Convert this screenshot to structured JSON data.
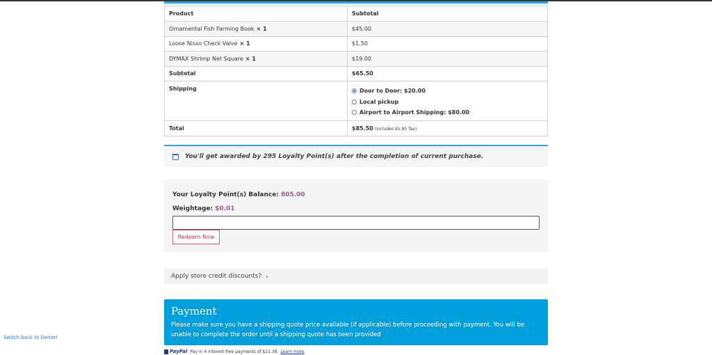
{
  "order_table": {
    "header_product": "Product",
    "header_subtotal": "Subtotal",
    "items": [
      {
        "name": "Ornamental Fish Farming Book",
        "qty": "× 1",
        "price": "$45.00"
      },
      {
        "name": "Loose Nisso Check Valve",
        "qty": "× 1",
        "price": "$1.50"
      },
      {
        "name": "DYMAX Shrimp Net Square",
        "qty": "× 1",
        "price": "$19.00"
      }
    ],
    "subtotal_label": "Subtotal",
    "subtotal_value": "$65.50",
    "shipping_label": "Shipping",
    "shipping_options": [
      {
        "label": "Door to Door: $20.00",
        "selected": true
      },
      {
        "label": "Local pickup",
        "selected": false
      },
      {
        "label": "Airport to Airport Shipping: $80.00",
        "selected": false
      }
    ],
    "total_label": "Total",
    "total_value": "$85.50",
    "total_tax_note": "(includes $5.95 Tax)"
  },
  "loyalty_message": "You'll get awarded by 295 Loyalty Point(s) after the completion of current purchase.",
  "redeem": {
    "balance_label": "Your Loyalty Point(s) Balance:",
    "balance_value": "805.00",
    "weightage_label": "Weightage:",
    "weightage_value": "$0.01",
    "input_value": "",
    "button_label": "Redeem Now"
  },
  "store_credit_label": "Apply store credit discounts?",
  "payment": {
    "title": "Payment",
    "notice": "Please make sure you have a shipping quote price available (if applicable) before proceeding with payment. You will be unable to complete the order until a shipping quote has been provided"
  },
  "paypal": {
    "logo_text": "PayPal",
    "message": "Pay in 4 interest-free payments of $21.38.",
    "link_text": "Learn more"
  },
  "switch_back_link": "Switch back to Denzel",
  "colors": {
    "accent": "#00a0dd",
    "points_purple": "#9b5a91",
    "redeem_red": "#c0394d"
  }
}
